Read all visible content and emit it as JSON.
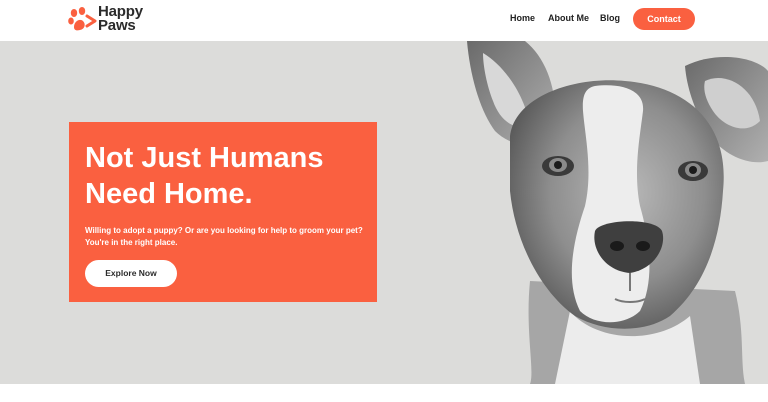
{
  "brand": {
    "line1": "Happy",
    "line2": "Paws",
    "logo_icon": "paw-icon",
    "color": "#fa6040"
  },
  "nav": {
    "items": [
      {
        "label": "Home"
      },
      {
        "label": "About Me"
      },
      {
        "label": "Blog"
      }
    ],
    "contact_label": "Contact"
  },
  "hero": {
    "title_line1": "Not Just Humans",
    "title_line2": "Need Home.",
    "text": "Willing to adopt a puppy? Or are you looking for help to groom your pet? You're in the right place.",
    "cta_label": "Explore Now",
    "accent": "#fa6040",
    "background": "#dcdcda"
  }
}
